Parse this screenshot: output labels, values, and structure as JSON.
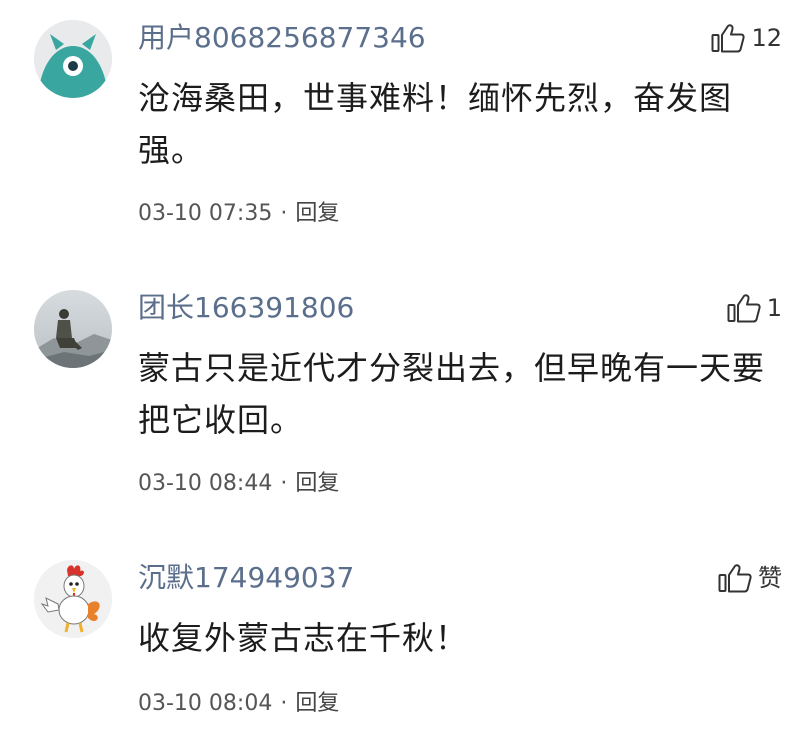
{
  "comments": [
    {
      "username": "用户8068256877346",
      "text": "沧海桑田，世事难料！缅怀先烈，奋发图强。",
      "timestamp": "03-10 07:35",
      "reply_label": "回复",
      "likes": "12",
      "avatar": "teal-cartoon-avatar"
    },
    {
      "username": "团长166391806",
      "text": "蒙古只是近代才分裂出去，但早晚有一天要把它收回。",
      "timestamp": "03-10 08:44",
      "reply_label": "回复",
      "likes": "1",
      "avatar": "photo-person-sitting-avatar"
    },
    {
      "username": "沉默174949037",
      "text": "收复外蒙古志在千秋！",
      "timestamp": "03-10 08:04",
      "reply_label": "回复",
      "likes": "赞",
      "avatar": "rooster-cartoon-avatar"
    }
  ],
  "separator": "·",
  "colors": {
    "username": "#5b6f8c",
    "text": "#1c1c1c",
    "meta": "#555555"
  },
  "icons": {
    "like": "thumbs-up-icon"
  }
}
